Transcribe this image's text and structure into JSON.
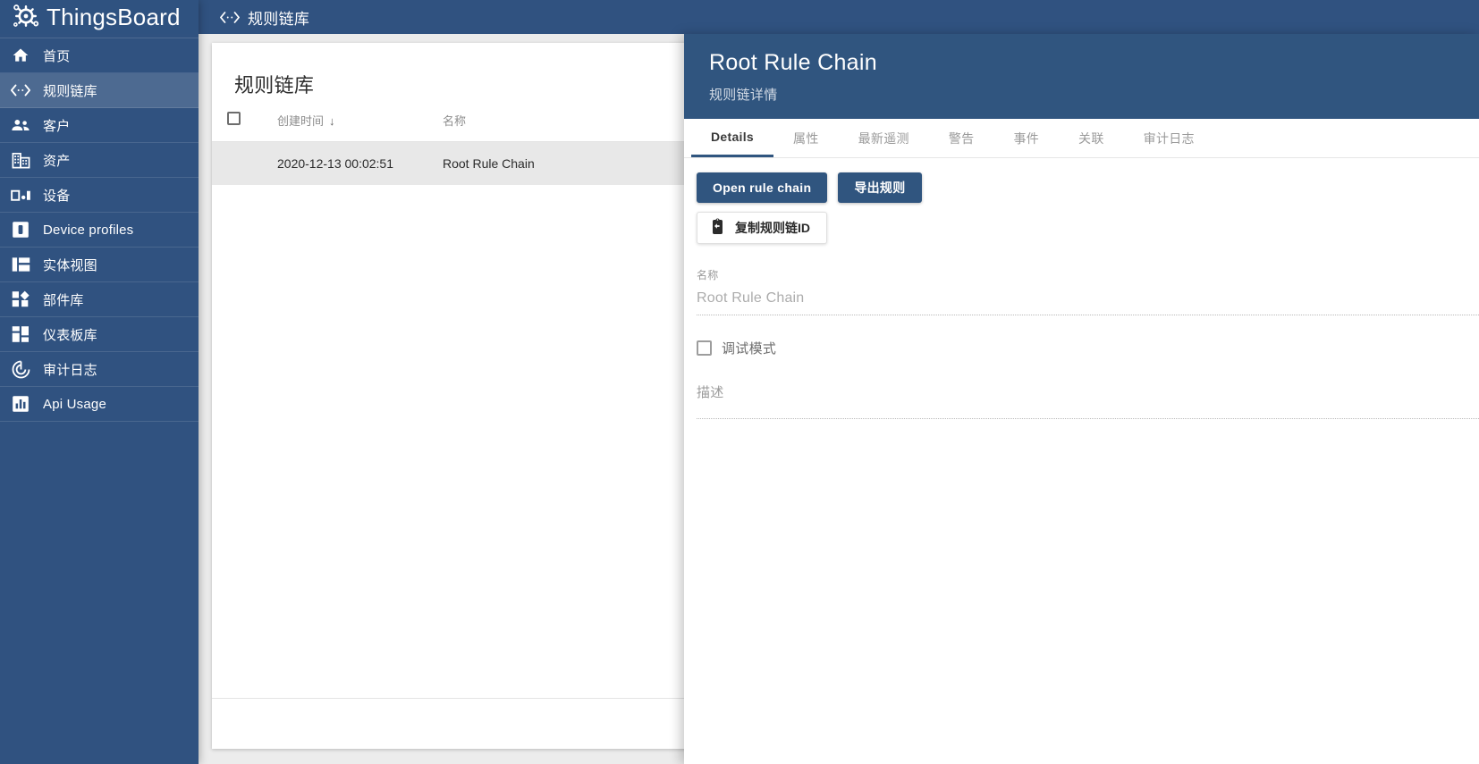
{
  "brand": {
    "name": "ThingsBoard",
    "logo_icon": "thingsboard-gear-logo"
  },
  "sidebar": {
    "items": [
      {
        "label": "首页",
        "icon": "home-icon",
        "active": false
      },
      {
        "label": "规则链库",
        "icon": "rule-chain-icon",
        "active": true
      },
      {
        "label": "客户",
        "icon": "customers-icon",
        "active": false
      },
      {
        "label": "资产",
        "icon": "assets-icon",
        "active": false
      },
      {
        "label": "设备",
        "icon": "devices-icon",
        "active": false
      },
      {
        "label": "Device profiles",
        "icon": "device-profile-icon",
        "active": false
      },
      {
        "label": "实体视图",
        "icon": "entity-view-icon",
        "active": false
      },
      {
        "label": "部件库",
        "icon": "widgets-icon",
        "active": false
      },
      {
        "label": "仪表板库",
        "icon": "dashboards-icon",
        "active": false
      },
      {
        "label": "审计日志",
        "icon": "audit-log-icon",
        "active": false
      },
      {
        "label": "Api Usage",
        "icon": "api-usage-icon",
        "active": false
      }
    ]
  },
  "toolbar": {
    "title": "规则链库",
    "icon": "rule-chain-icon"
  },
  "main": {
    "card_title": "规则链库",
    "table": {
      "select_all_checkbox": "unchecked",
      "columns": [
        {
          "label": "创建时间",
          "sorted": true,
          "sort_direction": "desc",
          "sort_arrow": "↓"
        },
        {
          "label": "名称",
          "sorted": false,
          "sort_arrow": ""
        }
      ],
      "rows": [
        {
          "created_time": "2020-12-13 00:02:51",
          "name": "Root Rule Chain",
          "selected": true
        }
      ]
    }
  },
  "detail": {
    "title": "Root Rule Chain",
    "subtitle": "规则链详情",
    "tabs": [
      {
        "label": "Details",
        "active": true
      },
      {
        "label": "属性",
        "active": false
      },
      {
        "label": "最新遥测",
        "active": false
      },
      {
        "label": "警告",
        "active": false
      },
      {
        "label": "事件",
        "active": false
      },
      {
        "label": "关联",
        "active": false
      },
      {
        "label": "审计日志",
        "active": false
      }
    ],
    "actions": {
      "open_rule_chain": "Open rule chain",
      "export_rule": "导出规则",
      "copy_rule_chain_id": "复制规则链ID",
      "copy_icon": "clipboard-copy-icon"
    },
    "form": {
      "name_label": "名称",
      "name_value": "Root Rule Chain",
      "debug_mode_label": "调试模式",
      "debug_mode_checked": false,
      "description_label": "描述",
      "description_value": ""
    }
  },
  "colors": {
    "brand_blue": "#305280",
    "panel_header_blue": "#30557f",
    "sidebar_active": "#4d6a91",
    "page_background": "#ececec",
    "row_selected": "#e8e8e8",
    "muted_text": "#9a9a9a"
  }
}
